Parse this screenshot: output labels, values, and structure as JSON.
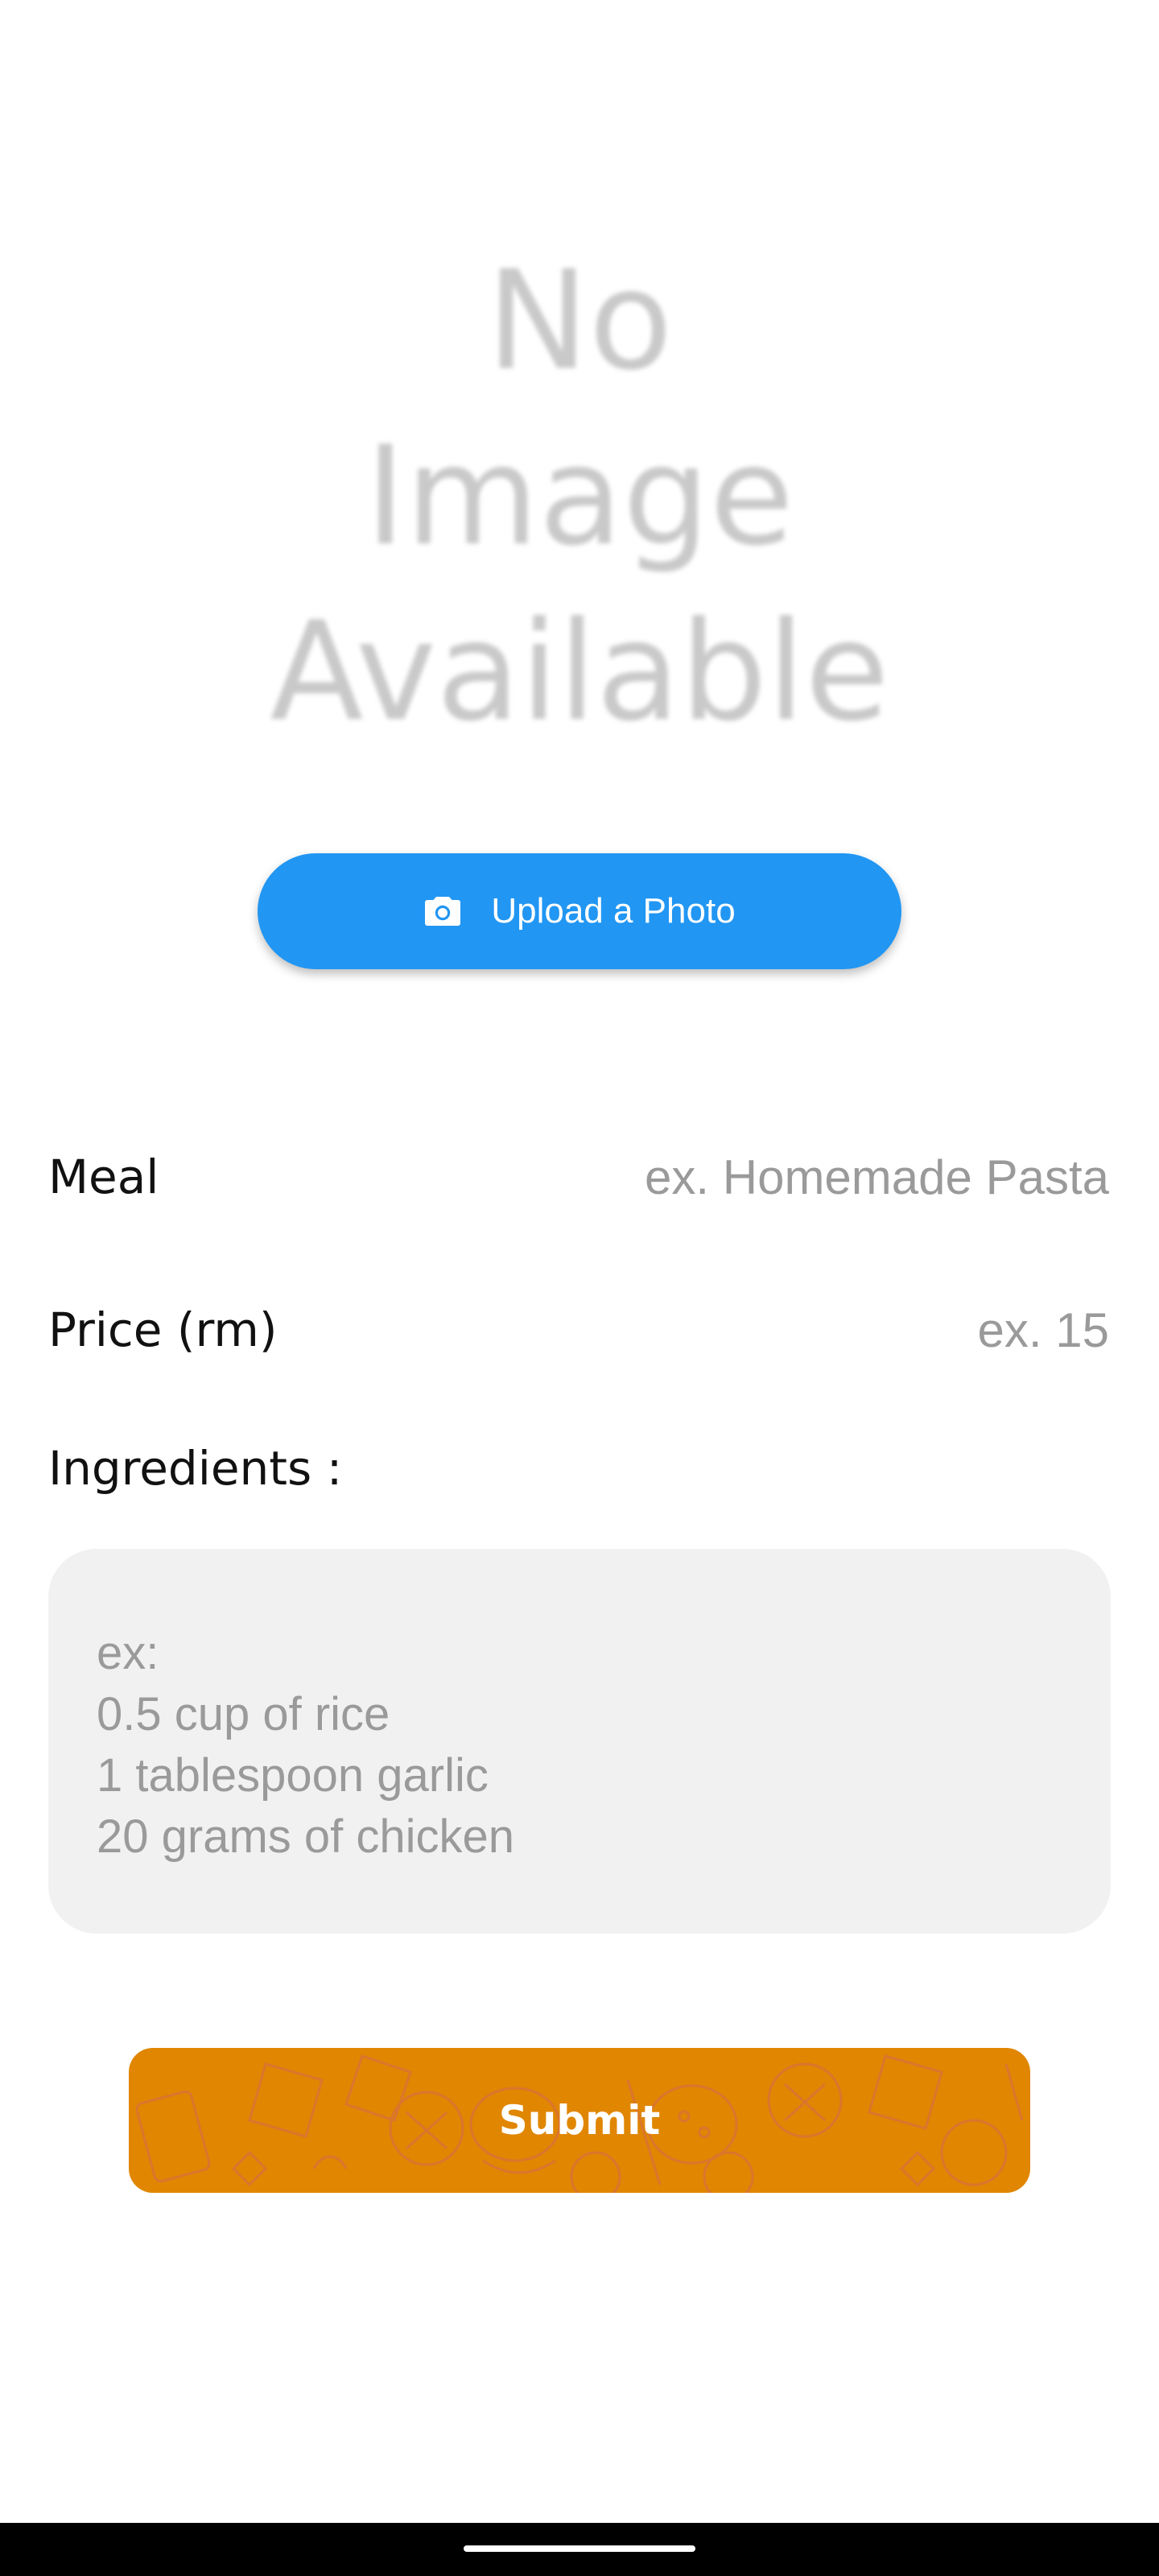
{
  "placeholder_image": {
    "line1": "No",
    "line2": "Image",
    "line3": "Available"
  },
  "upload": {
    "label": "Upload a Photo",
    "icon": "camera-icon"
  },
  "meal": {
    "label": "Meal",
    "placeholder": "ex. Homemade Pasta"
  },
  "price": {
    "label": "Price (rm)",
    "placeholder": "ex. 15"
  },
  "ingredients": {
    "label": "Ingredients :",
    "placeholder": "ex:\n0.5 cup of rice\n1 tablespoon garlic\n20 grams of chicken"
  },
  "submit": {
    "label": "Submit"
  },
  "colors": {
    "upload_button": "#2196f3",
    "submit_button": "#e08600",
    "input_background": "#f1f1f1",
    "placeholder_text": "#9a9a9a"
  }
}
